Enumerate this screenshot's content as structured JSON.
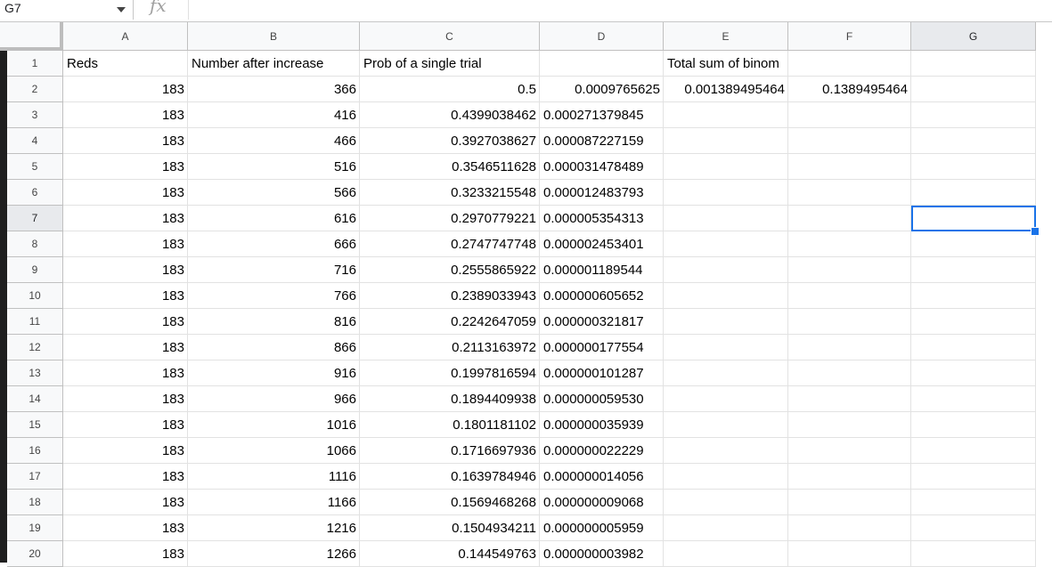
{
  "formula_bar": {
    "name_box": "G7",
    "fx_icon": "fx-icon",
    "formula": ""
  },
  "columns": [
    "A",
    "B",
    "C",
    "D",
    "E",
    "F",
    "G"
  ],
  "selected_cell": "G7",
  "rows": [
    {
      "n": "1",
      "A": "Reds",
      "B": "Number after increase",
      "C": "Prob of a single trial",
      "D": "",
      "E": "Total sum of binom",
      "F": "",
      "G": ""
    },
    {
      "n": "2",
      "A": "183",
      "B": "366",
      "C": "0.5",
      "D": "0.0009765625",
      "E": "0.001389495464",
      "F": "0.1389495464",
      "G": ""
    },
    {
      "n": "3",
      "A": "183",
      "B": "416",
      "C": "0.4399038462",
      "D": "0.000271379845",
      "E": "",
      "F": "",
      "G": ""
    },
    {
      "n": "4",
      "A": "183",
      "B": "466",
      "C": "0.3927038627",
      "D": "0.000087227159",
      "E": "",
      "F": "",
      "G": ""
    },
    {
      "n": "5",
      "A": "183",
      "B": "516",
      "C": "0.3546511628",
      "D": "0.000031478489",
      "E": "",
      "F": "",
      "G": ""
    },
    {
      "n": "6",
      "A": "183",
      "B": "566",
      "C": "0.3233215548",
      "D": "0.000012483793",
      "E": "",
      "F": "",
      "G": ""
    },
    {
      "n": "7",
      "A": "183",
      "B": "616",
      "C": "0.2970779221",
      "D": "0.000005354313",
      "E": "",
      "F": "",
      "G": ""
    },
    {
      "n": "8",
      "A": "183",
      "B": "666",
      "C": "0.2747747748",
      "D": "0.000002453401",
      "E": "",
      "F": "",
      "G": ""
    },
    {
      "n": "9",
      "A": "183",
      "B": "716",
      "C": "0.2555865922",
      "D": "0.000001189544",
      "E": "",
      "F": "",
      "G": ""
    },
    {
      "n": "10",
      "A": "183",
      "B": "766",
      "C": "0.2389033943",
      "D": "0.000000605652",
      "E": "",
      "F": "",
      "G": ""
    },
    {
      "n": "11",
      "A": "183",
      "B": "816",
      "C": "0.2242647059",
      "D": "0.000000321817",
      "E": "",
      "F": "",
      "G": ""
    },
    {
      "n": "12",
      "A": "183",
      "B": "866",
      "C": "0.2113163972",
      "D": "0.000000177554",
      "E": "",
      "F": "",
      "G": ""
    },
    {
      "n": "13",
      "A": "183",
      "B": "916",
      "C": "0.1997816594",
      "D": "0.000000101287",
      "E": "",
      "F": "",
      "G": ""
    },
    {
      "n": "14",
      "A": "183",
      "B": "966",
      "C": "0.1894409938",
      "D": "0.000000059530",
      "E": "",
      "F": "",
      "G": ""
    },
    {
      "n": "15",
      "A": "183",
      "B": "1016",
      "C": "0.1801181102",
      "D": "0.000000035939",
      "E": "",
      "F": "",
      "G": ""
    },
    {
      "n": "16",
      "A": "183",
      "B": "1066",
      "C": "0.1716697936",
      "D": "0.000000022229",
      "E": "",
      "F": "",
      "G": ""
    },
    {
      "n": "17",
      "A": "183",
      "B": "1116",
      "C": "0.1639784946",
      "D": "0.000000014056",
      "E": "",
      "F": "",
      "G": ""
    },
    {
      "n": "18",
      "A": "183",
      "B": "1166",
      "C": "0.1569468268",
      "D": "0.000000009068",
      "E": "",
      "F": "",
      "G": ""
    },
    {
      "n": "19",
      "A": "183",
      "B": "1216",
      "C": "0.1504934211",
      "D": "0.000000005959",
      "E": "",
      "F": "",
      "G": ""
    },
    {
      "n": "20",
      "A": "183",
      "B": "1266",
      "C": "0.144549763",
      "D": "0.000000003982",
      "E": "",
      "F": "",
      "G": ""
    }
  ],
  "colors": {
    "selection": "#1a73e8",
    "header_bg": "#f8f9fa",
    "grid_line": "#e2e2e2"
  }
}
